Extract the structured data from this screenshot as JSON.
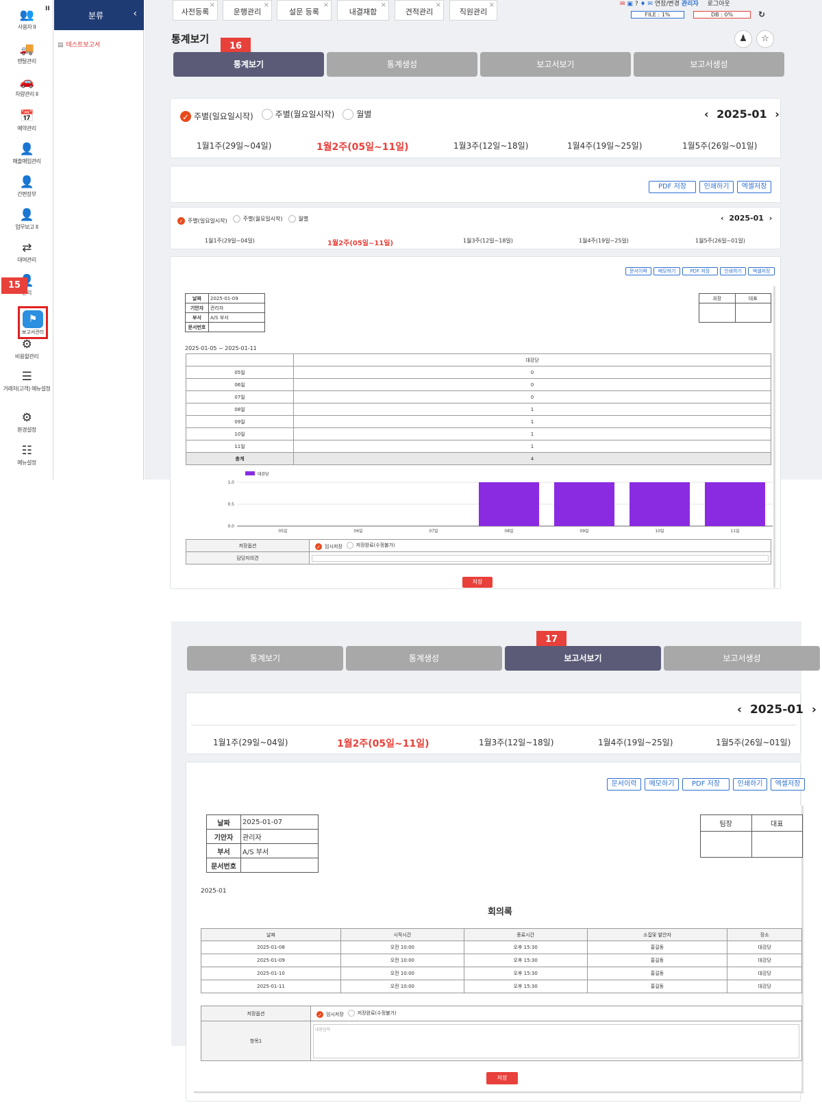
{
  "iconbar": {
    "items": [
      {
        "icon": "users-icon",
        "glyph": "👥",
        "label": "사용자 II"
      },
      {
        "icon": "truck-icon",
        "glyph": "🚚",
        "label": "렌탈관리"
      },
      {
        "icon": "car-icon",
        "glyph": "🚗",
        "label": "차량관리 II"
      },
      {
        "icon": "calendar-icon",
        "glyph": "📅",
        "label": "예약관리"
      },
      {
        "icon": "person-money-icon",
        "glyph": "👤",
        "label": "매출매입관리"
      },
      {
        "icon": "person-ledger-icon",
        "glyph": "👤",
        "label": "간편장부"
      },
      {
        "icon": "person-report-icon",
        "glyph": "👤",
        "label": "업무보고 II"
      },
      {
        "icon": "swap-icon",
        "glyph": "⇄",
        "label": "대여관리"
      },
      {
        "icon": "person-tag-icon",
        "glyph": "👤",
        "label": "관리"
      },
      {
        "icon": "gears-icon",
        "glyph": "⚙",
        "label": "비용할관리"
      },
      {
        "icon": "menu-icon",
        "glyph": "☰",
        "label": "거래처(고객) 메뉴설정"
      },
      {
        "icon": "gear-icon",
        "glyph": "⚙",
        "label": "환경설정"
      },
      {
        "icon": "list-icon",
        "glyph": "☷",
        "label": "메뉴설정"
      }
    ],
    "highlighted_label": "보고서관리",
    "collapse_glyph": "II"
  },
  "category": {
    "title": "분류",
    "collapse": "‹",
    "item": "테스트보고서"
  },
  "tabs": [
    {
      "label": "사전등록"
    },
    {
      "label": "운행관리"
    },
    {
      "label": "설문 등록"
    },
    {
      "label": "내결재함"
    },
    {
      "label": "견적관리"
    },
    {
      "label": "직원관리"
    }
  ],
  "topbar": {
    "links": "연장/변경",
    "admin": "관리자",
    "logout": "로그아웃",
    "file": "FILE : 1%",
    "db": "DB : 0%",
    "refresh": "↻"
  },
  "page_title": "통계보기",
  "badges": {
    "b15": "15",
    "b16": "16",
    "b17": "17"
  },
  "mode_tabs": [
    "통계보기",
    "통계생성",
    "보고서보기",
    "보고서생성"
  ],
  "radios": [
    "주별(일요일시작)",
    "주별(월요일시작)",
    "월별"
  ],
  "period": {
    "prev": "‹",
    "label": "2025-01",
    "next": "›"
  },
  "weeks": [
    "1월1주(29일~04일)",
    "1월2주(05일~11일)",
    "1월3주(12일~18일)",
    "1월4주(19일~25일)",
    "1월5주(26일~01일)"
  ],
  "actions_large": [
    "PDF 저장",
    "인쇄하기",
    "엑셀저장"
  ],
  "actions_small": [
    "문서이력",
    "메모하기",
    "PDF 저장",
    "인쇄하기",
    "엑셀저장"
  ],
  "report1": {
    "info": [
      [
        "날짜",
        "2025-01-09"
      ],
      [
        "기안자",
        "관리자"
      ],
      [
        "부서",
        "A/S 부서"
      ],
      [
        "문서번호",
        ""
      ]
    ],
    "approval": [
      "과장",
      "대표"
    ],
    "range": "2025-01-05 ~ 2025-01-11",
    "col": "대강당",
    "rows": [
      [
        "05일",
        "0"
      ],
      [
        "06일",
        "0"
      ],
      [
        "07일",
        "0"
      ],
      [
        "08일",
        "1"
      ],
      [
        "09일",
        "1"
      ],
      [
        "10일",
        "1"
      ],
      [
        "11일",
        "1"
      ],
      [
        "총계",
        "4"
      ]
    ],
    "save_option_label": "저장옵션",
    "save_opts": [
      "임시저장",
      "저장완료(수정불가)"
    ],
    "opinion_label": "담당자의견",
    "save": "저장"
  },
  "chart_data": {
    "type": "bar",
    "categories": [
      "05일",
      "06일",
      "07일",
      "08일",
      "09일",
      "10일",
      "11일"
    ],
    "series": [
      {
        "name": "대강당",
        "values": [
          0,
          0,
          0,
          1,
          1,
          1,
          1
        ]
      }
    ],
    "ylim": [
      0,
      1
    ],
    "yticks": [
      "1.0",
      "0.5",
      "0.0"
    ],
    "color": "#8a2be2",
    "legend": "top-left"
  },
  "report2": {
    "info": [
      [
        "날짜",
        "2025-01-07"
      ],
      [
        "기안자",
        "관리자"
      ],
      [
        "부서",
        "A/S 부서"
      ],
      [
        "문서번호",
        ""
      ]
    ],
    "approval": [
      "팀장",
      "대표"
    ],
    "period": "2025-01",
    "title": "회의록",
    "headers": [
      "날짜",
      "시작시간",
      "종료시간",
      "소집및 발안자",
      "장소"
    ],
    "rows": [
      [
        "2025-01-08",
        "오전 10:00",
        "오후 15:30",
        "홍길동",
        "대강당"
      ],
      [
        "2025-01-09",
        "오전 10:00",
        "오후 15:30",
        "홍길동",
        "대강당"
      ],
      [
        "2025-01-10",
        "오전 10:00",
        "오후 15:30",
        "홍길동",
        "대강당"
      ],
      [
        "2025-01-11",
        "오전 10:00",
        "오후 15:30",
        "홍길동",
        "대강당"
      ]
    ],
    "save_option_label": "저장옵션",
    "save_opts": [
      "임시저장",
      "저장완료(수정불가)"
    ],
    "item_label": "항목1",
    "placeholder": "내용입력",
    "save": "저장"
  }
}
